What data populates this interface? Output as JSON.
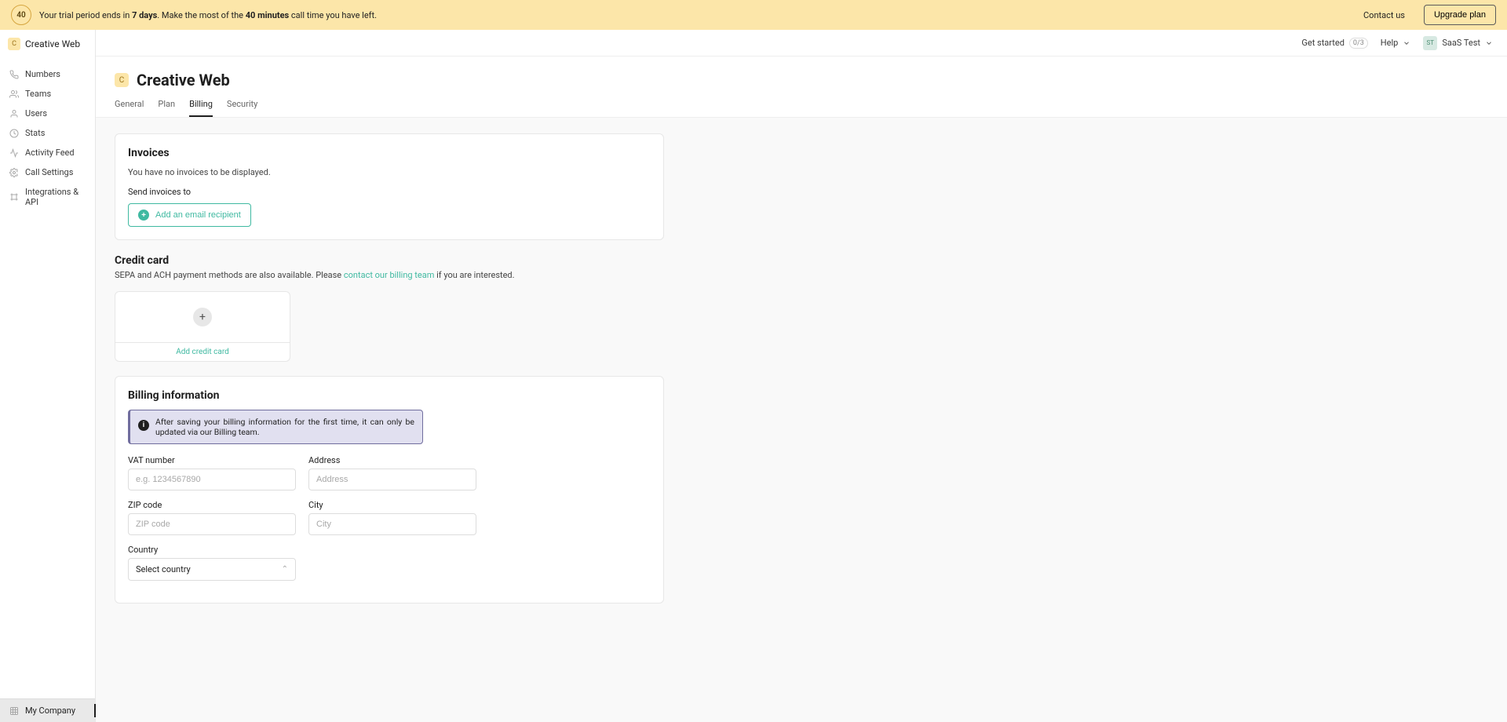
{
  "trial": {
    "circle": "40",
    "text_prefix": "Your trial period ends in ",
    "days_bold": "7 days",
    "text_mid": ". Make the most of the ",
    "mins_bold": "40 minutes",
    "text_suffix": " call time you have left.",
    "contact": "Contact us",
    "upgrade": "Upgrade plan"
  },
  "sidebar": {
    "header_initial": "C",
    "header_label": "Creative Web",
    "items": [
      {
        "label": "Numbers"
      },
      {
        "label": "Teams"
      },
      {
        "label": "Users"
      },
      {
        "label": "Stats"
      },
      {
        "label": "Activity Feed"
      },
      {
        "label": "Call Settings"
      },
      {
        "label": "Integrations & API"
      }
    ],
    "footer_label": "My Company"
  },
  "topbar": {
    "get_started": "Get started",
    "badge": "0/3",
    "help": "Help",
    "avatar": "ST",
    "user": "SaaS Test"
  },
  "page": {
    "initial": "C",
    "title": "Creative Web",
    "tabs": [
      {
        "label": "General",
        "active": false
      },
      {
        "label": "Plan",
        "active": false
      },
      {
        "label": "Billing",
        "active": true
      },
      {
        "label": "Security",
        "active": false
      }
    ]
  },
  "invoices": {
    "title": "Invoices",
    "empty": "You have no invoices to be displayed.",
    "send_label": "Send invoices to",
    "add_btn": "Add an email recipient"
  },
  "credit_card": {
    "title": "Credit card",
    "sub_prefix": "SEPA and ACH payment methods are also available. Please ",
    "sub_link": "contact our billing team",
    "sub_suffix": " if you are interested.",
    "add_label": "Add credit card"
  },
  "billing_info": {
    "title": "Billing information",
    "alert": "After saving your billing information for the first time, it can only be updated via our Billing team.",
    "fields": {
      "vat": {
        "label": "VAT number",
        "placeholder": "e.g. 1234567890"
      },
      "address": {
        "label": "Address",
        "placeholder": "Address"
      },
      "zip": {
        "label": "ZIP code",
        "placeholder": "ZIP code"
      },
      "city": {
        "label": "City",
        "placeholder": "City"
      },
      "country": {
        "label": "Country",
        "placeholder": "Select country"
      }
    }
  }
}
